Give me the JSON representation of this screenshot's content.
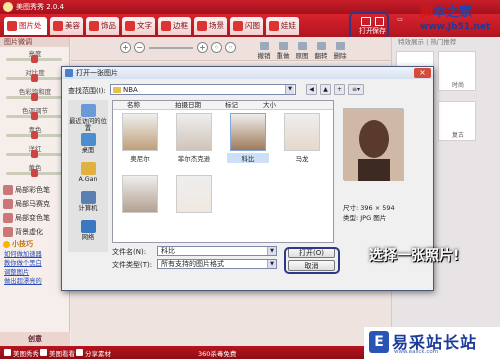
{
  "app": {
    "title": "美图秀秀 2.0.4"
  },
  "tabs": [
    {
      "label": "图片处理",
      "icon": "image-edit-icon"
    },
    {
      "label": "美容",
      "icon": "face-icon"
    },
    {
      "label": "饰品",
      "icon": "heart-icon"
    },
    {
      "label": "文字",
      "icon": "text-icon"
    },
    {
      "label": "边框",
      "icon": "frame-icon"
    },
    {
      "label": "场景",
      "icon": "scene-icon"
    },
    {
      "label": "闪图",
      "icon": "flash-icon"
    },
    {
      "label": "娃娃",
      "icon": "doll-icon"
    }
  ],
  "top_actions": {
    "open": "打开",
    "save": "保存"
  },
  "watermark": {
    "text_a": "脚",
    "text_b": "本之家",
    "url": "www.Jb51.net"
  },
  "left_panel": {
    "header": "图片微调",
    "sliders": [
      {
        "label": "亮度",
        "level": 0.5
      },
      {
        "label": "对比度",
        "level": 0.5
      },
      {
        "label": "色彩饱和度",
        "level": 0.5
      },
      {
        "label": "色调调节",
        "level": 0.5
      },
      {
        "label": "青色",
        "level": 0.5
      },
      {
        "label": "洋红",
        "level": 0.5
      },
      {
        "label": "黄色",
        "level": 0.5
      }
    ],
    "effects": [
      {
        "label": "局部彩色笔",
        "icon": "color-pen-icon"
      },
      {
        "label": "局部马赛克",
        "icon": "mosaic-icon"
      },
      {
        "label": "局部变色笔",
        "icon": "brush-icon"
      },
      {
        "label": "背景虚化",
        "icon": "blur-icon"
      }
    ],
    "tips_title": "小技巧",
    "tips": [
      "如何做加速器",
      "教你做个黑白",
      "调整图片",
      "做出超漂亮的"
    ],
    "footer": "创意"
  },
  "toolbar2": {
    "items": [
      "撤销",
      "重做",
      "原图",
      "翻转",
      "删除"
    ]
  },
  "right_panel": {
    "header": "特效展示 | 热门推荐",
    "thumbs": [
      "风格化",
      "时尚",
      "去斑",
      "复古"
    ]
  },
  "bottom_bar": {
    "items": [
      "美图秀秀",
      "美图看看",
      "分享素材"
    ],
    "center": "360杀毒免费"
  },
  "logo": {
    "text": "易采站长站",
    "url": "www.easck.com",
    "mark": "E"
  },
  "dialog": {
    "title": "打开一张图片",
    "look_in_label": "查找范围(I):",
    "look_in_value": "NBA",
    "places": [
      {
        "label": "最近访问的位置",
        "icon": "recent-icon"
      },
      {
        "label": "桌面",
        "icon": "desktop-icon"
      },
      {
        "label": "A.Gan",
        "icon": "user-icon"
      },
      {
        "label": "计算机",
        "icon": "computer-icon"
      },
      {
        "label": "网络",
        "icon": "network-icon"
      }
    ],
    "columns": [
      "名称",
      "拍摄日期",
      "标记",
      "大小"
    ],
    "files": [
      "奥尼尔",
      "菲尔杰克逊",
      "科比",
      "马龙",
      "",
      ""
    ],
    "selected_index": 2,
    "preview": {
      "size": "尺寸: 396 × 594",
      "type": "类型: JPG 图片"
    },
    "filename_label": "文件名(N):",
    "filename_value": "科比",
    "filetype_label": "文件类型(T):",
    "filetype_value": "所有支持的图片格式",
    "open_button": "打开(O)",
    "cancel_button": "取消"
  },
  "annotation": "选择一张照片!"
}
